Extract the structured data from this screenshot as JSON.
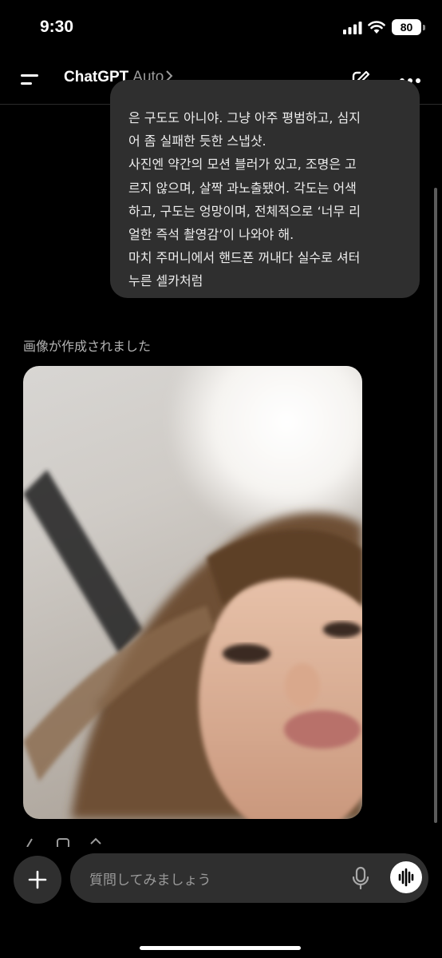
{
  "status_bar": {
    "time": "9:30",
    "battery": "80"
  },
  "header": {
    "app_name": "ChatGPT",
    "model": "Auto"
  },
  "user_message": {
    "lines": [
      "은 구도도 아니야. 그냥 아주 평범하고, 심지",
      "어 좀 실패한 듯한 스냅샷.",
      "사진엔 약간의 모션 블러가 있고, 조명은 고",
      "르지 않으며, 살짝 과노출됐어. 각도는 어색",
      "하고, 구도는 엉망이며, 전체적으로 ‘너무 리",
      "얼한 즉석 촬영감’이 나와야 해.",
      "마치 주머니에서 핸드폰 꺼내다 실수로 셔터",
      "누른 셀카처럼"
    ]
  },
  "assistant": {
    "status": "画像が作成されました"
  },
  "composer": {
    "placeholder": "質問してみましょう"
  },
  "colors": {
    "background": "#000000",
    "bubble": "#2f2f2f",
    "muted_text": "#9b9b9b"
  }
}
